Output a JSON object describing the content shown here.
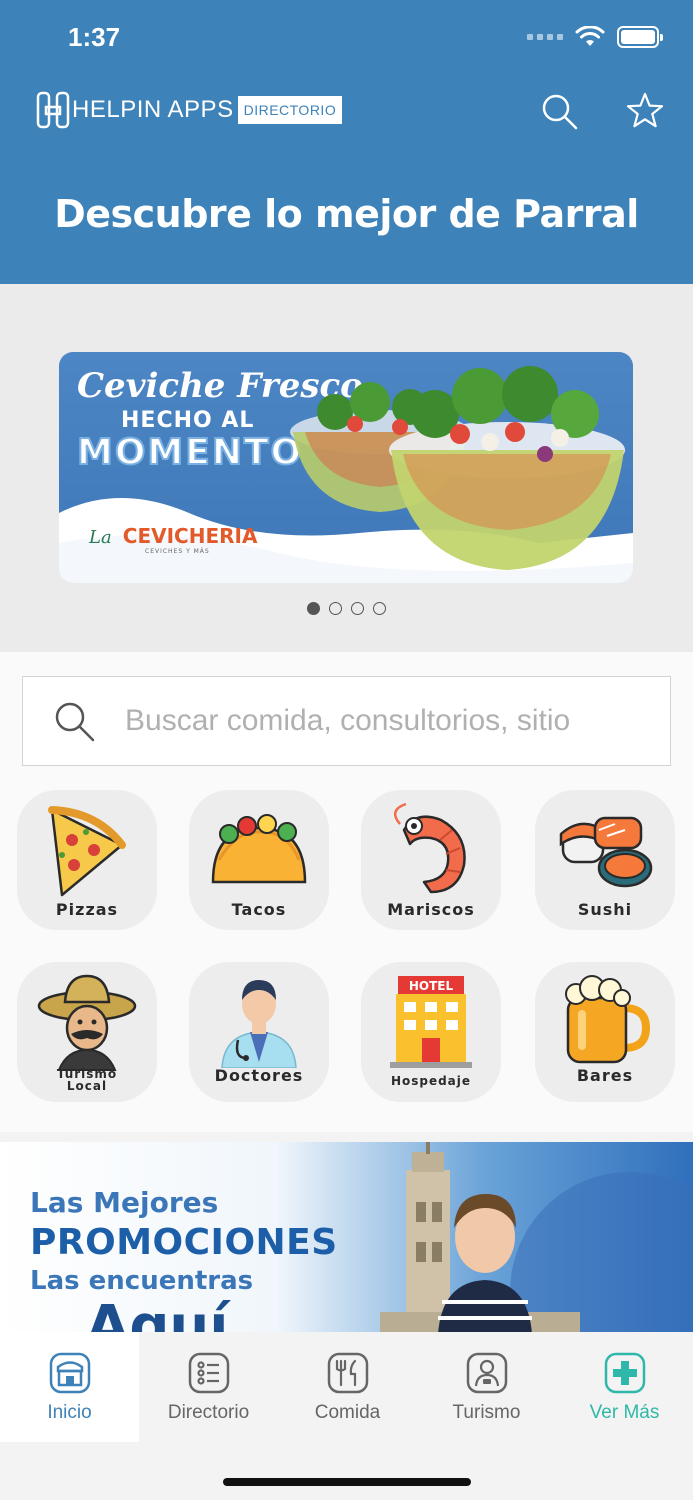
{
  "status_bar": {
    "time": "1:37"
  },
  "header": {
    "logo_name": "HELPIN APPS",
    "logo_tag": "DIRECTORIO",
    "title": "Descubre lo mejor de Parral"
  },
  "carousel": {
    "banner": {
      "line1": "Ceviche Fresco",
      "line2": "HECHO AL",
      "line3": "MOMENTO",
      "brand_prefix": "La",
      "brand_name": "CEVICHERIA",
      "brand_sub": "CEVICHES Y MÁS"
    },
    "page_count": 4,
    "active_page": 1
  },
  "search": {
    "placeholder": "Buscar comida, consultorios, sitio"
  },
  "categories": [
    {
      "label": "Pizzas",
      "icon": "pizza-icon"
    },
    {
      "label": "Tacos",
      "icon": "taco-icon"
    },
    {
      "label": "Mariscos",
      "icon": "shrimp-icon"
    },
    {
      "label": "Sushi",
      "icon": "sushi-icon"
    },
    {
      "label": "Turismo Local",
      "icon": "sombrero-man-icon"
    },
    {
      "label": "Doctores",
      "icon": "doctor-icon"
    },
    {
      "label": "Hospedaje",
      "icon": "hotel-icon",
      "sign": "HOTEL"
    },
    {
      "label": "Bares",
      "icon": "beer-mug-icon"
    }
  ],
  "promo": {
    "line1": "Las Mejores",
    "line2": "PROMOCIONES",
    "line3": "Las encuentras",
    "line4": "Aquí"
  },
  "tabbar": {
    "items": [
      {
        "label": "Inicio",
        "icon": "store-icon",
        "active": true
      },
      {
        "label": "Directorio",
        "icon": "list-icon"
      },
      {
        "label": "Comida",
        "icon": "fork-knife-icon"
      },
      {
        "label": "Turismo",
        "icon": "person-icon"
      },
      {
        "label": "Ver Más",
        "icon": "plus-icon"
      }
    ]
  },
  "colors": {
    "header": "#3d82b8",
    "accent_green": "#2fb8a9",
    "text_muted": "#666666"
  }
}
